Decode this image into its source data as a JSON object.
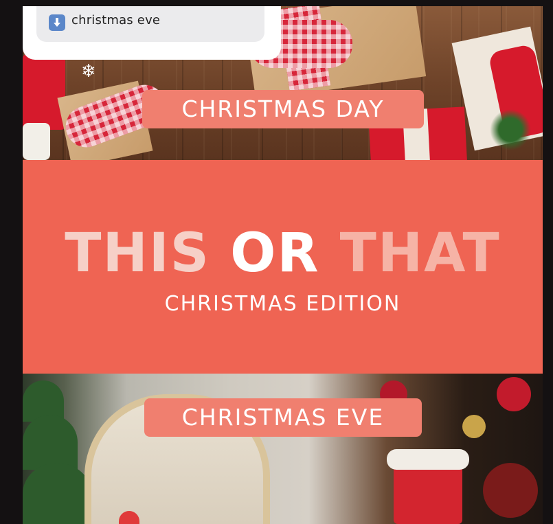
{
  "notification": {
    "icon": "download-arrow-icon",
    "text": "christmas eve"
  },
  "option_top": {
    "label": "CHRISTMAS DAY"
  },
  "banner": {
    "title_this": "THIS",
    "title_or": "OR",
    "title_that": "THAT",
    "subtitle": "CHRISTMAS EDITION"
  },
  "option_bottom": {
    "label": "CHRISTMAS EVE"
  },
  "colors": {
    "banner": "#ef6453",
    "pill": "#f07f6f",
    "notification_icon": "#5b87c9"
  }
}
